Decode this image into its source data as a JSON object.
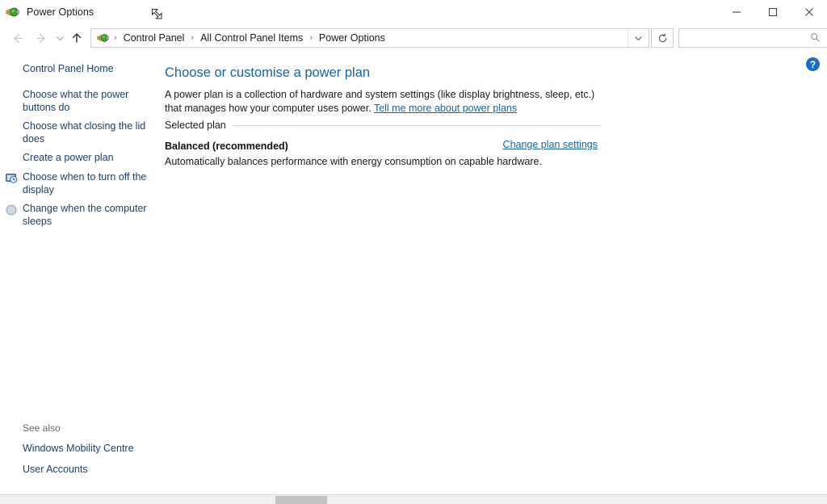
{
  "window": {
    "title": "Power Options",
    "app_icon": "power-plug-icon",
    "controls": {
      "minimize": "—",
      "maximize": "☐",
      "close": "✕"
    }
  },
  "navbar": {
    "back": "back-arrow-icon",
    "forward": "forward-arrow-icon",
    "recent": "recent-locations-icon",
    "up": "up-arrow-icon",
    "breadcrumb": [
      {
        "label": "Control Panel"
      },
      {
        "label": "All Control Panel Items"
      },
      {
        "label": "Power Options"
      }
    ],
    "separator": "›",
    "dropdown": "chevron-down-icon",
    "refresh": "refresh-icon",
    "search": {
      "value": "",
      "placeholder": "",
      "icon": "search-icon"
    }
  },
  "sidebar": {
    "home": "Control Panel Home",
    "items": [
      {
        "label": "Choose what the power buttons do",
        "shield": false
      },
      {
        "label": "Choose what closing the lid does",
        "shield": false
      },
      {
        "label": "Create a power plan",
        "shield": false
      },
      {
        "label": "Choose when to turn off the display",
        "shield": true,
        "icon": "display-clock-icon"
      },
      {
        "label": "Change when the computer sleeps",
        "shield": true,
        "icon": "sleep-moon-icon"
      }
    ],
    "see_also": {
      "title": "See also",
      "items": [
        {
          "label": "Windows Mobility Centre"
        },
        {
          "label": "User Accounts"
        }
      ]
    }
  },
  "main": {
    "help_icon": "?",
    "title": "Choose or customise a power plan",
    "description_part1": "A power plan is a collection of hardware and system settings (like display brightness, sleep, etc.) that manages how your computer uses power. ",
    "description_link": "Tell me more about power plans",
    "section_label": "Selected plan",
    "plan": {
      "name": "Balanced (recommended)",
      "change_link": "Change plan settings",
      "description": "Automatically balances performance with energy consumption on capable hardware."
    }
  },
  "scrollbar": {
    "orientation": "horizontal"
  },
  "colors": {
    "link": "#1464a8",
    "nav_link": "#1f3f6b",
    "title": "#1464a8",
    "help_badge": "#1a6fc4",
    "accent": "#0a56a8"
  }
}
